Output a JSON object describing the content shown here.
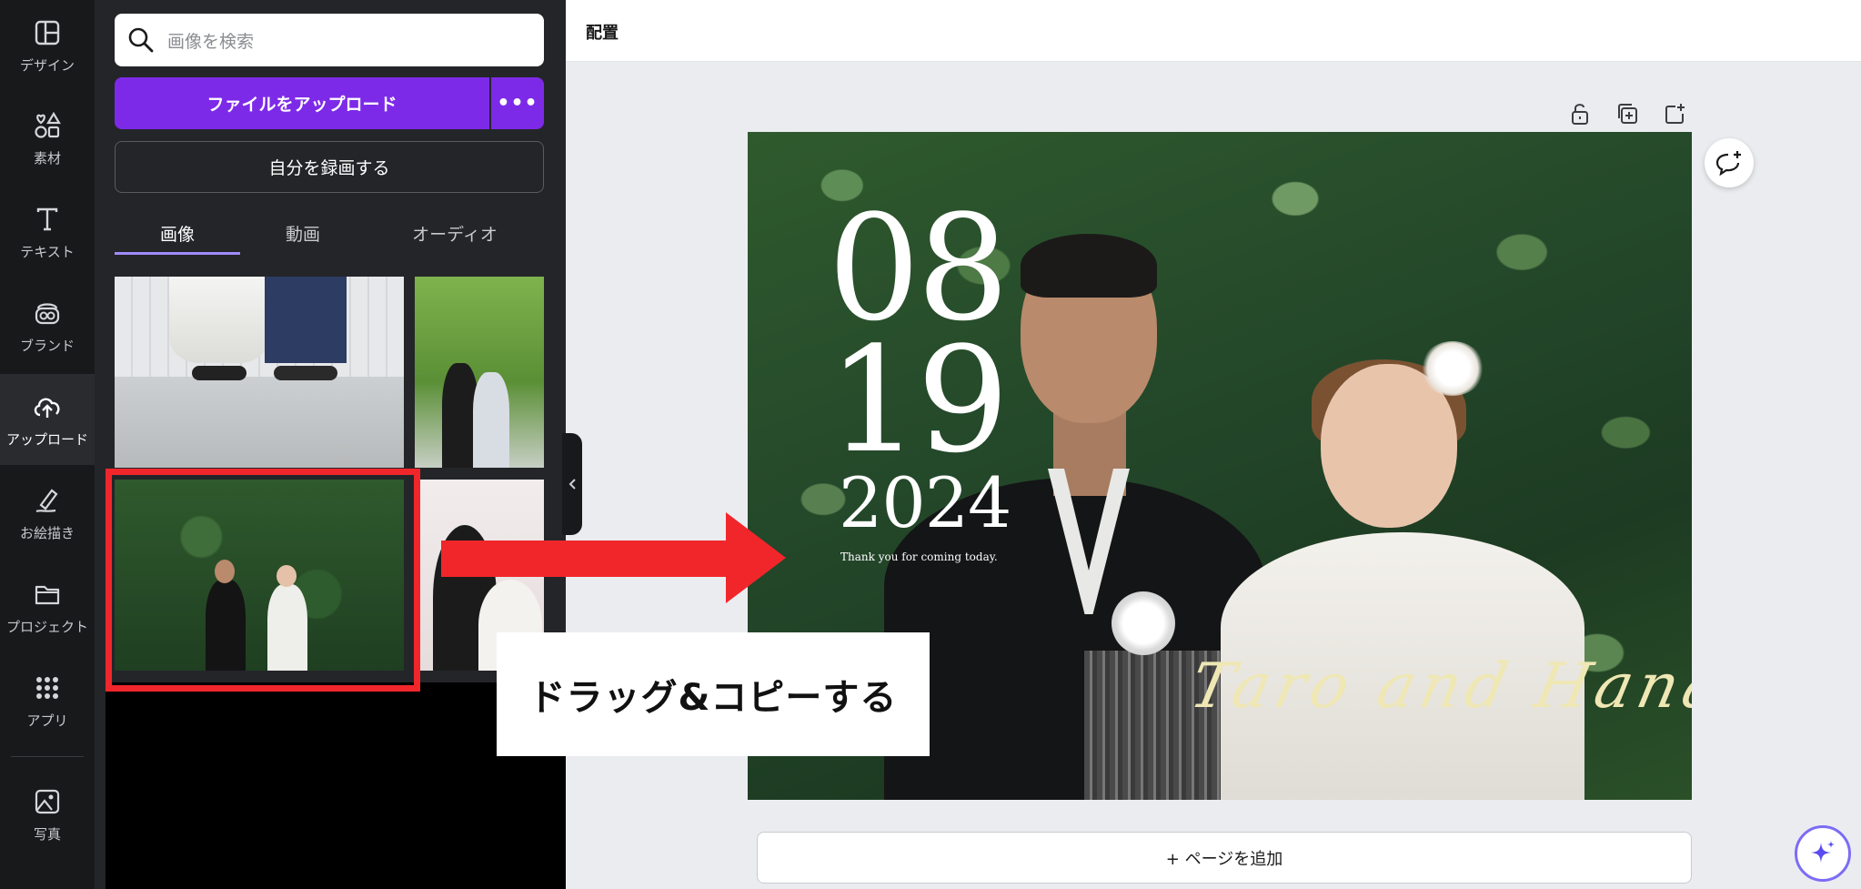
{
  "rail": {
    "items": [
      {
        "label": "デザイン",
        "icon": "layout-icon"
      },
      {
        "label": "素材",
        "icon": "shapes-icon"
      },
      {
        "label": "テキスト",
        "icon": "text-icon"
      },
      {
        "label": "ブランド",
        "icon": "brand-icon"
      },
      {
        "label": "アップロード",
        "icon": "cloud-upload-icon"
      },
      {
        "label": "お絵描き",
        "icon": "pen-icon"
      },
      {
        "label": "プロジェクト",
        "icon": "folder-icon"
      },
      {
        "label": "アプリ",
        "icon": "apps-grid-icon"
      },
      {
        "label": "写真",
        "icon": "photo-icon"
      }
    ],
    "active_index": 4
  },
  "panel": {
    "search_placeholder": "画像を検索",
    "upload_button": "ファイルをアップロード",
    "more_button": "•••",
    "record_button": "自分を録画する",
    "tabs": [
      "画像",
      "動画",
      "オーディオ"
    ],
    "active_tab": 0
  },
  "topbar": {
    "title": "配置"
  },
  "canvas": {
    "date_month": "08",
    "date_day": "19",
    "date_year": "2024",
    "thanks": "Thank you for coming today.",
    "names": "Taro  and  Hana",
    "add_page": "+ ページを追加"
  },
  "annotation": {
    "callout": "ドラッグ&コピーする"
  },
  "colors": {
    "accent_purple": "#7d2ae8",
    "annotation_red": "#f1262b",
    "rail_bg": "#18191b",
    "panel_bg": "#242529",
    "canvas_bg": "#ebecf0"
  }
}
